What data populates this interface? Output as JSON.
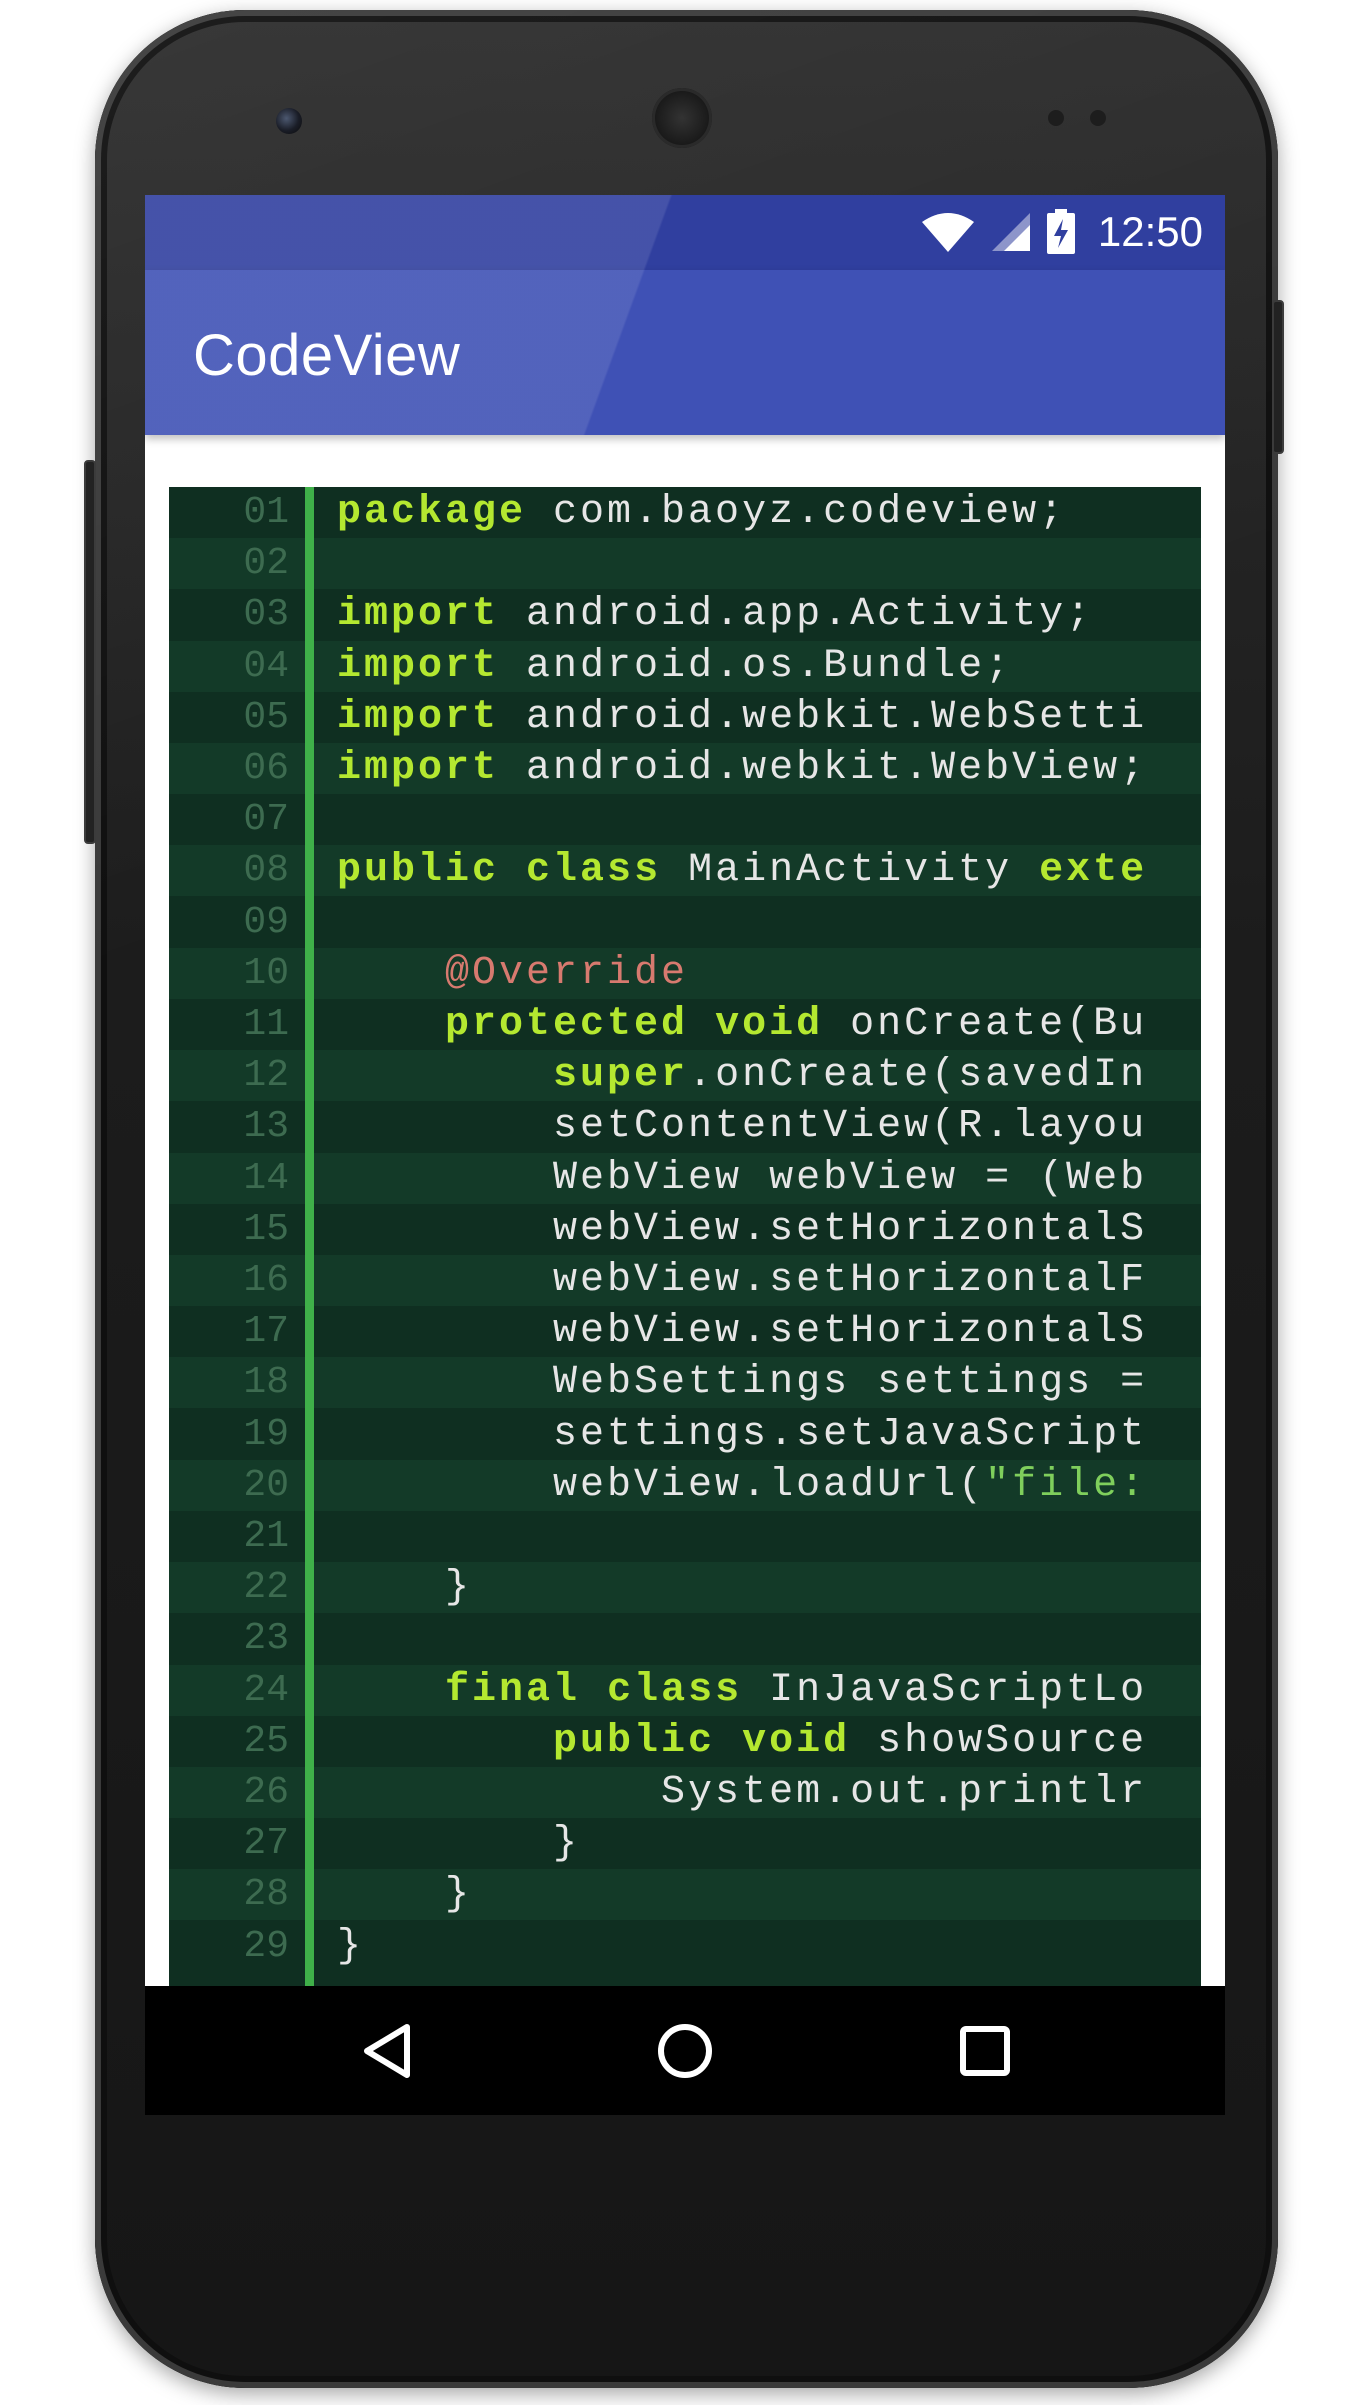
{
  "status_bar": {
    "time": "12:50",
    "icons": [
      "wifi-icon",
      "cellular-signal-icon",
      "battery-charging-icon"
    ]
  },
  "app_bar": {
    "title": "CodeView"
  },
  "colors": {
    "status_bar": "#303f9f",
    "app_bar": "#3f51b5",
    "code_background": "#0f2f21",
    "gutter_accent": "#3fb049",
    "keyword": "#b4e830",
    "annotation": "#d77a6f",
    "string": "#7fcf5c"
  },
  "code": {
    "language": "java",
    "lines": [
      {
        "n": "01",
        "tokens": [
          [
            "kw",
            "package"
          ],
          [
            "t",
            " com.baoyz.codeview;"
          ]
        ]
      },
      {
        "n": "02",
        "tokens": []
      },
      {
        "n": "03",
        "tokens": [
          [
            "kw",
            "import"
          ],
          [
            "t",
            " android.app.Activity;"
          ]
        ]
      },
      {
        "n": "04",
        "tokens": [
          [
            "kw",
            "import"
          ],
          [
            "t",
            " android.os.Bundle;"
          ]
        ]
      },
      {
        "n": "05",
        "tokens": [
          [
            "kw",
            "import"
          ],
          [
            "t",
            " android.webkit.WebSetti"
          ]
        ]
      },
      {
        "n": "06",
        "tokens": [
          [
            "kw",
            "import"
          ],
          [
            "t",
            " android.webkit.WebView;"
          ]
        ]
      },
      {
        "n": "07",
        "tokens": []
      },
      {
        "n": "08",
        "tokens": [
          [
            "kw",
            "public"
          ],
          [
            "t",
            " "
          ],
          [
            "kw",
            "class"
          ],
          [
            "t",
            " MainActivity "
          ],
          [
            "kw",
            "exte"
          ]
        ]
      },
      {
        "n": "09",
        "tokens": []
      },
      {
        "n": "10",
        "tokens": [
          [
            "t",
            "    "
          ],
          [
            "an",
            "@Override"
          ]
        ]
      },
      {
        "n": "11",
        "tokens": [
          [
            "t",
            "    "
          ],
          [
            "kw",
            "protected"
          ],
          [
            "t",
            " "
          ],
          [
            "kw",
            "void"
          ],
          [
            "t",
            " onCreate(Bu"
          ]
        ]
      },
      {
        "n": "12",
        "tokens": [
          [
            "t",
            "        "
          ],
          [
            "kw",
            "super"
          ],
          [
            "t",
            ".onCreate(savedIn"
          ]
        ]
      },
      {
        "n": "13",
        "tokens": [
          [
            "t",
            "        setContentView(R.layou"
          ]
        ]
      },
      {
        "n": "14",
        "tokens": [
          [
            "t",
            "        WebView webView = (Web"
          ]
        ]
      },
      {
        "n": "15",
        "tokens": [
          [
            "t",
            "        webView.setHorizontalS"
          ]
        ]
      },
      {
        "n": "16",
        "tokens": [
          [
            "t",
            "        webView.setHorizontalF"
          ]
        ]
      },
      {
        "n": "17",
        "tokens": [
          [
            "t",
            "        webView.setHorizontalS"
          ]
        ]
      },
      {
        "n": "18",
        "tokens": [
          [
            "t",
            "        WebSettings settings ="
          ]
        ]
      },
      {
        "n": "19",
        "tokens": [
          [
            "t",
            "        settings.setJavaScript"
          ]
        ]
      },
      {
        "n": "20",
        "tokens": [
          [
            "t",
            "        webView.loadUrl("
          ],
          [
            "st",
            "\"file:"
          ]
        ]
      },
      {
        "n": "21",
        "tokens": []
      },
      {
        "n": "22",
        "tokens": [
          [
            "t",
            "    }"
          ]
        ]
      },
      {
        "n": "23",
        "tokens": []
      },
      {
        "n": "24",
        "tokens": [
          [
            "t",
            "    "
          ],
          [
            "kw",
            "final"
          ],
          [
            "t",
            " "
          ],
          [
            "kw",
            "class"
          ],
          [
            "t",
            " InJavaScriptLo"
          ]
        ]
      },
      {
        "n": "25",
        "tokens": [
          [
            "t",
            "        "
          ],
          [
            "kw",
            "public"
          ],
          [
            "t",
            " "
          ],
          [
            "kw",
            "void"
          ],
          [
            "t",
            " showSource"
          ]
        ]
      },
      {
        "n": "26",
        "tokens": [
          [
            "t",
            "            System.out.printlr"
          ]
        ]
      },
      {
        "n": "27",
        "tokens": [
          [
            "t",
            "        }"
          ]
        ]
      },
      {
        "n": "28",
        "tokens": [
          [
            "t",
            "    }"
          ]
        ]
      },
      {
        "n": "29",
        "tokens": [
          [
            "t",
            "}"
          ]
        ]
      }
    ]
  },
  "nav_bar": {
    "buttons": [
      "back-icon",
      "home-icon",
      "recents-icon"
    ]
  }
}
